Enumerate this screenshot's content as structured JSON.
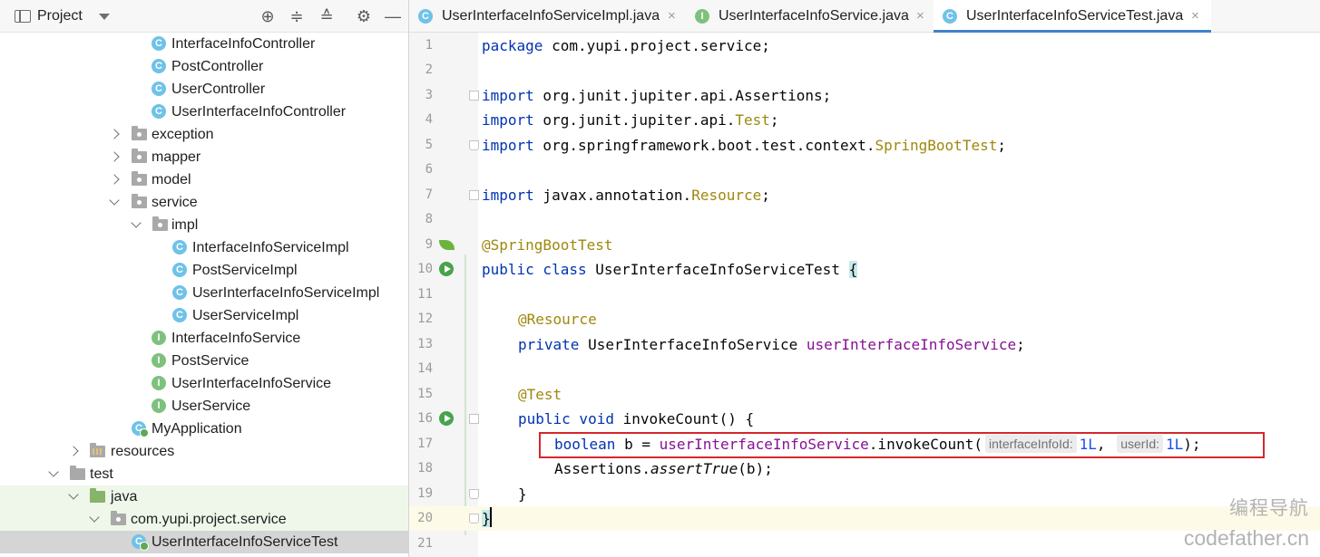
{
  "project_panel": {
    "title": "Project",
    "tree": [
      {
        "label": "InterfaceInfoController",
        "kind": "class"
      },
      {
        "label": "PostController",
        "kind": "class"
      },
      {
        "label": "UserController",
        "kind": "class"
      },
      {
        "label": "UserInterfaceInfoController",
        "kind": "class"
      },
      {
        "label": "exception",
        "kind": "package"
      },
      {
        "label": "mapper",
        "kind": "package"
      },
      {
        "label": "model",
        "kind": "package"
      },
      {
        "label": "service",
        "kind": "package"
      },
      {
        "label": "impl",
        "kind": "package"
      },
      {
        "label": "InterfaceInfoServiceImpl",
        "kind": "class"
      },
      {
        "label": "PostServiceImpl",
        "kind": "class"
      },
      {
        "label": "UserInterfaceInfoServiceImpl",
        "kind": "class"
      },
      {
        "label": "UserServiceImpl",
        "kind": "class"
      },
      {
        "label": "InterfaceInfoService",
        "kind": "interface"
      },
      {
        "label": "PostService",
        "kind": "interface"
      },
      {
        "label": "UserInterfaceInfoService",
        "kind": "interface"
      },
      {
        "label": "UserService",
        "kind": "interface"
      },
      {
        "label": "MyApplication",
        "kind": "app-class"
      },
      {
        "label": "resources",
        "kind": "resources-folder"
      },
      {
        "label": "test",
        "kind": "folder"
      },
      {
        "label": "java",
        "kind": "test-source-folder"
      },
      {
        "label": "com.yupi.project.service",
        "kind": "package"
      },
      {
        "label": "UserInterfaceInfoServiceTest",
        "kind": "test-class"
      }
    ]
  },
  "tabs": [
    {
      "label": "UserInterfaceInfoServiceImpl.java",
      "icon": "class-icon",
      "active": false
    },
    {
      "label": "UserInterfaceInfoService.java",
      "icon": "interface-icon",
      "active": false
    },
    {
      "label": "UserInterfaceInfoServiceTest.java",
      "icon": "class-icon",
      "active": true
    }
  ],
  "close_glyph": "×",
  "editor": {
    "line_numbers": [
      "1",
      "2",
      "3",
      "4",
      "5",
      "6",
      "7",
      "8",
      "9",
      "10",
      "11",
      "12",
      "13",
      "14",
      "15",
      "16",
      "17",
      "18",
      "19",
      "20",
      "21"
    ],
    "code": {
      "l1_kw": "package",
      "l1_rest": " com.yupi.project.service;",
      "l3_kw": "import",
      "l3_rest": " org.junit.jupiter.api.Assertions;",
      "l4_kw": "import",
      "l4_a": " org.junit.jupiter.api.",
      "l4_b": "Test",
      "l4_c": ";",
      "l5_kw": "import",
      "l5_a": " org.springframework.boot.test.context.",
      "l5_b": "SpringBootTest",
      "l5_c": ";",
      "l7_kw": "import",
      "l7_a": " javax.annotation.",
      "l7_b": "Resource",
      "l7_c": ";",
      "l9_ann": "@SpringBootTest",
      "l10_kw": "public class",
      "l10_rest": " UserInterfaceInfoServiceTest ",
      "l10_brace": "{",
      "l12_ann": "@Resource",
      "l13_kw": "private",
      "l13_type": " UserInterfaceInfoService ",
      "l13_field": "userInterfaceInfoService",
      "l13_end": ";",
      "l15_ann": "@Test",
      "l16_kw": "public void",
      "l16_rest": " invokeCount() {",
      "l17_kw": "boolean",
      "l17_a": " b = ",
      "l17_field": "userInterfaceInfoService",
      "l17_b": ".invokeCount(",
      "l17_hint1": "interfaceInfoId:",
      "l17_arg1": "1L",
      "l17_comma": ",",
      "l17_hint2": "userId:",
      "l17_arg2": "1L",
      "l17_end": ");",
      "l18_a": "Assertions.",
      "l18_method": "assertTrue",
      "l18_b": "(b);",
      "l19": "}",
      "l20": "}"
    }
  },
  "watermark": {
    "line1": "编程导航",
    "line2": "codefather.cn"
  }
}
